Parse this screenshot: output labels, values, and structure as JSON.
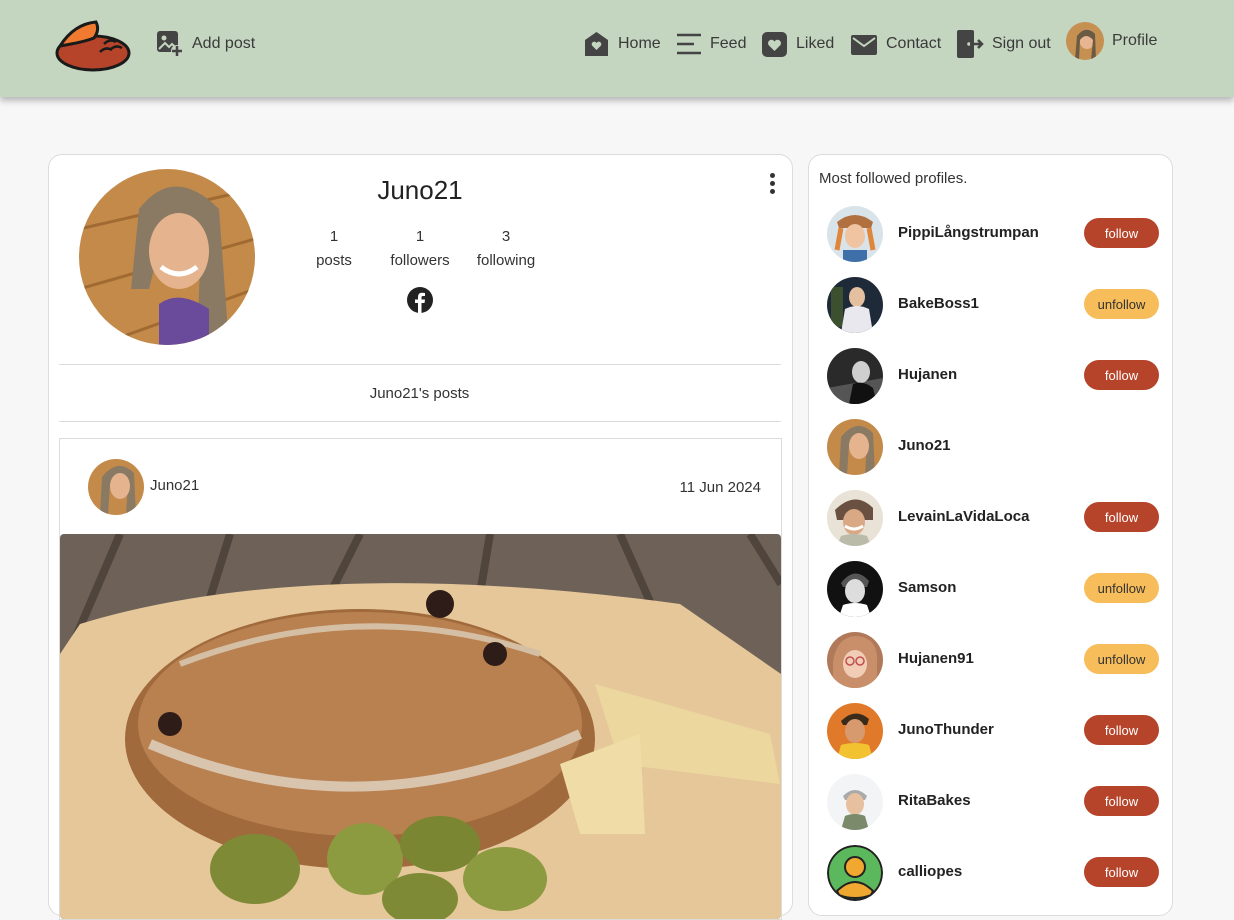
{
  "nav": {
    "add_post": "Add post",
    "home": "Home",
    "feed": "Feed",
    "liked": "Liked",
    "contact": "Contact",
    "sign_out": "Sign out",
    "profile": "Profile"
  },
  "profile": {
    "username": "Juno21",
    "posts_count": "1",
    "posts_label": "posts",
    "followers_count": "1",
    "followers_label": "followers",
    "following_count": "3",
    "following_label": "following",
    "posts_heading": "Juno21's posts"
  },
  "post": {
    "username": "Juno21",
    "date": "11 Jun 2024"
  },
  "sidebar": {
    "title": "Most followed profiles.",
    "profiles": [
      {
        "name": "PippiLångstrumpan",
        "button": "follow"
      },
      {
        "name": "BakeBoss1",
        "button": "unfollow"
      },
      {
        "name": "Hujanen",
        "button": "follow"
      },
      {
        "name": "Juno21",
        "button": ""
      },
      {
        "name": "LevainLaVidaLoca",
        "button": "follow"
      },
      {
        "name": "Samson",
        "button": "unfollow"
      },
      {
        "name": "Hujanen91",
        "button": "unfollow"
      },
      {
        "name": "JunoThunder",
        "button": "follow"
      },
      {
        "name": "RitaBakes",
        "button": "follow"
      },
      {
        "name": "calliopes",
        "button": "follow"
      }
    ]
  },
  "colors": {
    "navbar": "#c4d5c0",
    "follow": "#b5442a",
    "unfollow": "#f7bd5a",
    "logo": "#b5442a"
  }
}
